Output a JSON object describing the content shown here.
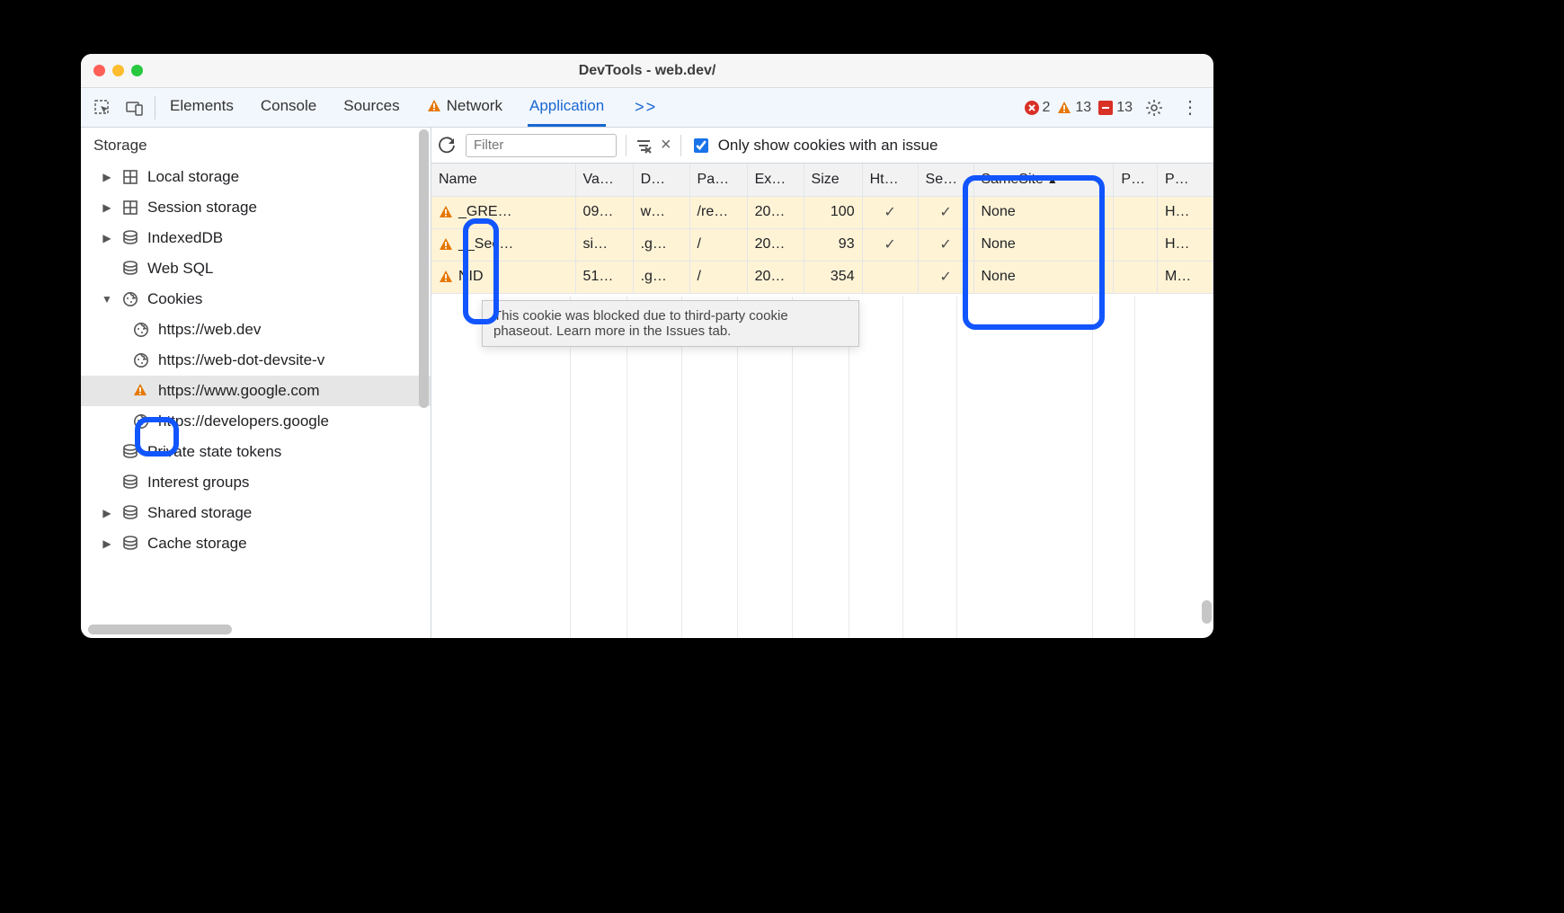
{
  "window": {
    "title": "DevTools - web.dev/"
  },
  "tabs": {
    "elements": "Elements",
    "console": "Console",
    "sources": "Sources",
    "network": "Network",
    "application": "Application"
  },
  "status": {
    "errors": "2",
    "warnings": "13",
    "issues": "13"
  },
  "sidebar": {
    "section": "Storage",
    "items": {
      "local": "Local storage",
      "session": "Session storage",
      "indexed": "IndexedDB",
      "websql": "Web SQL",
      "cookies": "Cookies",
      "cookie_origins": [
        "https://web.dev",
        "https://web-dot-devsite-v",
        "https://www.google.com",
        "https://developers.google"
      ],
      "private_tokens": "Private state tokens",
      "interest": "Interest groups",
      "shared": "Shared storage",
      "cache": "Cache storage"
    }
  },
  "toolbar": {
    "filter_placeholder": "Filter",
    "only_issues_label": "Only show cookies with an issue"
  },
  "columns": {
    "name": "Name",
    "value": "Va…",
    "domain": "D…",
    "path": "Pa…",
    "expires": "Ex…",
    "size": "Size",
    "http": "Ht…",
    "secure": "Se…",
    "samesite": "SameSite",
    "partition": "P…",
    "priority": "P…"
  },
  "rows": [
    {
      "name": "_GRE…",
      "value": "09…",
      "domain": "w…",
      "path": "/re…",
      "expires": "20…",
      "size": "100",
      "http": "✓",
      "secure": "✓",
      "samesite": "None",
      "partition": "",
      "priority": "H…"
    },
    {
      "name": "__Sec…",
      "value": "si…",
      "domain": ".g…",
      "path": "/",
      "expires": "20…",
      "size": "93",
      "http": "✓",
      "secure": "✓",
      "samesite": "None",
      "partition": "",
      "priority": "H…"
    },
    {
      "name": "NID",
      "value": "51…",
      "domain": ".g…",
      "path": "/",
      "expires": "20…",
      "size": "354",
      "http": "",
      "secure": "✓",
      "samesite": "None",
      "partition": "",
      "priority": "M…"
    }
  ],
  "tooltip": "This cookie was blocked due to third-party cookie phaseout. Learn more in the Issues tab."
}
